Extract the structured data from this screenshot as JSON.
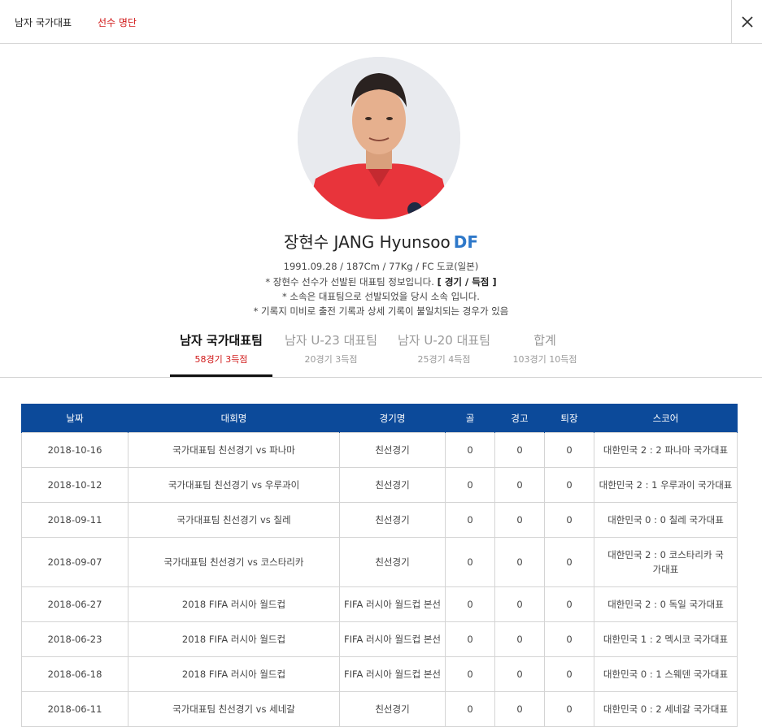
{
  "header": {
    "crumb_primary": "남자 국가대표",
    "crumb_active": "선수 명단",
    "accent_color": "#d11a1a"
  },
  "player": {
    "name": "장현수 JANG Hyunsoo",
    "position": "DF",
    "position_color": "#2e78c9",
    "details": "1991.09.28 / 187Cm / 77Kg / FC 도쿄(일본)",
    "note1_prefix": "* 장현수 선수가 선발된 대표팀 정보입니다.",
    "note1_bold": "[ 경기 / 득점 ]",
    "note2": "* 소속은 대표팀으로 선발되었을 당시 소속 입니다.",
    "note3": "* 기록지 미비로 출전 기록과 상세 기록이 불일치되는 경우가 있음"
  },
  "tabs": [
    {
      "label": "남자 국가대표팀",
      "sub": "58경기 3득점",
      "active": true
    },
    {
      "label": "남자 U-23 대표팀",
      "sub": "20경기 3득점",
      "active": false
    },
    {
      "label": "남자 U-20 대표팀",
      "sub": "25경기 4득점",
      "active": false
    },
    {
      "label": "합계",
      "sub": "103경기 10득점",
      "active": false
    }
  ],
  "table": {
    "header_color": "#0c4a9a",
    "columns": [
      "날짜",
      "대회명",
      "경기명",
      "골",
      "경고",
      "퇴장",
      "스코어"
    ],
    "rows": [
      {
        "date": "2018-10-16",
        "competition": "국가대표팀 친선경기 vs 파나마",
        "match": "친선경기",
        "goals": "0",
        "yellow": "0",
        "red": "0",
        "score": "대한민국 2 : 2 파나마 국가대표"
      },
      {
        "date": "2018-10-12",
        "competition": "국가대표팀 친선경기 vs 우루과이",
        "match": "친선경기",
        "goals": "0",
        "yellow": "0",
        "red": "0",
        "score": "대한민국 2 : 1 우루과이 국가대표"
      },
      {
        "date": "2018-09-11",
        "competition": "국가대표팀 친선경기 vs 칠레",
        "match": "친선경기",
        "goals": "0",
        "yellow": "0",
        "red": "0",
        "score": "대한민국 0 : 0 칠레 국가대표"
      },
      {
        "date": "2018-09-07",
        "competition": "국가대표팀 친선경기 vs 코스타리카",
        "match": "친선경기",
        "goals": "0",
        "yellow": "0",
        "red": "0",
        "score": "대한민국 2 : 0 코스타리카 국가대표"
      },
      {
        "date": "2018-06-27",
        "competition": "2018 FIFA 러시아 월드컵",
        "match": "FIFA 러시아 월드컵 본선",
        "goals": "0",
        "yellow": "0",
        "red": "0",
        "score": "대한민국 2 : 0 독일 국가대표"
      },
      {
        "date": "2018-06-23",
        "competition": "2018 FIFA 러시아 월드컵",
        "match": "FIFA 러시아 월드컵 본선",
        "goals": "0",
        "yellow": "0",
        "red": "0",
        "score": "대한민국 1 : 2 멕시코 국가대표"
      },
      {
        "date": "2018-06-18",
        "competition": "2018 FIFA 러시아 월드컵",
        "match": "FIFA 러시아 월드컵 본선",
        "goals": "0",
        "yellow": "0",
        "red": "0",
        "score": "대한민국 0 : 1 스웨덴 국가대표"
      },
      {
        "date": "2018-06-11",
        "competition": "국가대표팀 친선경기 vs 세네갈",
        "match": "친선경기",
        "goals": "0",
        "yellow": "0",
        "red": "0",
        "score": "대한민국 0 : 2 세네갈 국가대표"
      }
    ]
  }
}
